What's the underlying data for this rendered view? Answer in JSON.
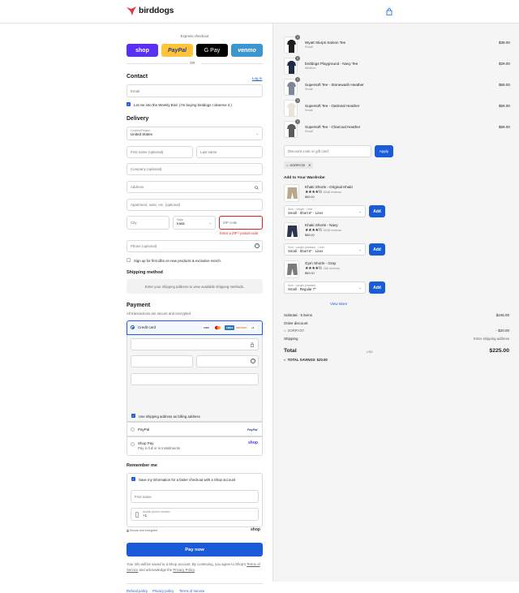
{
  "brand": {
    "name": "birddogs",
    "logo_color": "#e8333a",
    "accent": "#1a5cd8"
  },
  "express": {
    "label": "Express checkout",
    "buttons": [
      {
        "label": "shop",
        "bg": "#5a31f4",
        "fg": "#ffffff"
      },
      {
        "label": "PayPal",
        "bg": "#ffc439",
        "fg": "#253b80"
      },
      {
        "label": "G Pay",
        "bg": "#000000",
        "fg": "#ffffff"
      },
      {
        "label": "venmo",
        "bg": "#3d95ce",
        "fg": "#ffffff"
      }
    ],
    "or": "OR"
  },
  "contact": {
    "title": "Contact",
    "login": "Log in",
    "email_placeholder": "Email",
    "newsletter": "Let me into the Weekly Bird. (I'm buying birddogs I deserve it.)"
  },
  "delivery": {
    "title": "Delivery",
    "country_label": "Country/Region",
    "country": "United States",
    "first_name": "First name (optional)",
    "last_name": "Last name",
    "company": "Company (optional)",
    "address": "Address",
    "apartment": "Apartment, suite, etc. (optional)",
    "city": "City",
    "state_label": "State",
    "state": "Iowa",
    "zip": "ZIP code",
    "zip_error": "Enter a ZIP / postal code",
    "phone": "Phone (optional)",
    "sms_signup": "Sign up for first dibs on new products & exclusive merch."
  },
  "shipping": {
    "title": "Shipping method",
    "message": "Enter your shipping address to view available shipping methods."
  },
  "payment": {
    "title": "Payment",
    "subtitle": "All transactions are secure and encrypted.",
    "credit_card": "Credit card",
    "card_brands": [
      "VISA",
      "MC",
      "AMEX",
      "DISCOVER",
      "+4"
    ],
    "billing_same": "Use shipping address as billing address",
    "paypal": "PayPal",
    "paypal_logo": "PayPal",
    "shoppay": "Shop Pay",
    "shoppay_sub": "Pay in full or in installments",
    "shoppay_logo": "shop"
  },
  "remember": {
    "title": "Remember me",
    "save_info": "Save my information for a faster checkout with a Shop account",
    "first_name": "First name",
    "mobile_label": "Mobile phone number",
    "mobile_value": "+1",
    "secure": "Secure and encrypted",
    "shop_logo": "shop"
  },
  "pay_now": "Pay now",
  "legal": {
    "text_before": "Your info will be saved to a Shop account. By continuing, you agree to Shop's",
    "terms": "Terms of Service",
    "text_mid": "and acknowledge the",
    "privacy": "Privacy Policy",
    "text_end": "."
  },
  "footer_links": [
    "Refund policy",
    "Privacy policy",
    "Terms of service"
  ],
  "cart": {
    "items": [
      {
        "name": "Wyatt Slurps Saloon Tee",
        "variant": "Small",
        "qty": "1",
        "price": "$39.00",
        "color": "#1e1e1e"
      },
      {
        "name": "birddogs Playground - Navy Tee",
        "variant": "Medium",
        "qty": "1",
        "price": "$29.00",
        "color": "#1f2a44"
      },
      {
        "name": "Supersoft Tee - Stonewash Heather",
        "variant": "Small",
        "qty": "1",
        "price": "$59.00",
        "color": "#7d8796"
      },
      {
        "name": "Supersoft Tee - Oatmeal Heather",
        "variant": "Small",
        "qty": "1",
        "price": "$59.00",
        "color": "#e8e4dc"
      },
      {
        "name": "Supersoft Tee - Charcoal Heather",
        "variant": "Small",
        "qty": "1",
        "price": "$59.00",
        "color": "#5a5c60"
      }
    ],
    "discount_placeholder": "Discount code or gift card",
    "apply": "Apply",
    "code": "SORRY20"
  },
  "wardrobe": {
    "title": "Add to Your Wardrobe",
    "items": [
      {
        "name": "Khaki Shorts - Original Khaki",
        "stars": "★★★★½",
        "reviews": "5548 reviews",
        "price": "$69.00",
        "sel_label": "Size · Length · Liner",
        "sel_value": "Small · Short 6\" · Liner",
        "add": "Add",
        "color": "#b8a98a"
      },
      {
        "name": "Khaki Shorts - Navy",
        "stars": "★★★★½",
        "reviews": "5548 reviews",
        "price": "$69.00",
        "sel_label": "Size · Length (Inseam) · Liner",
        "sel_value": "Small · Short 6\" · Liner",
        "add": "Add",
        "color": "#2a3550"
      },
      {
        "name": "Gym Shorts - Gray",
        "stars": "★★★★½",
        "reviews": "456 reviews",
        "price": "$69.00",
        "sel_label": "Size · Length (Inseam)",
        "sel_value": "Small · Regular 7\"",
        "add": "Add",
        "color": "#7c7c7c"
      }
    ],
    "view_more": "View More"
  },
  "summary": {
    "subtotal_label": "Subtotal · 5 items",
    "subtotal": "$245.00",
    "order_discount": "Order discount",
    "code": "SORRY20",
    "discount": "- $20.00",
    "shipping_label": "Shipping",
    "shipping_value": "Enter shipping address",
    "total_label": "Total",
    "currency": "USD",
    "total": "$225.00",
    "savings_label": "TOTAL SAVINGS",
    "savings": "$20.00"
  }
}
